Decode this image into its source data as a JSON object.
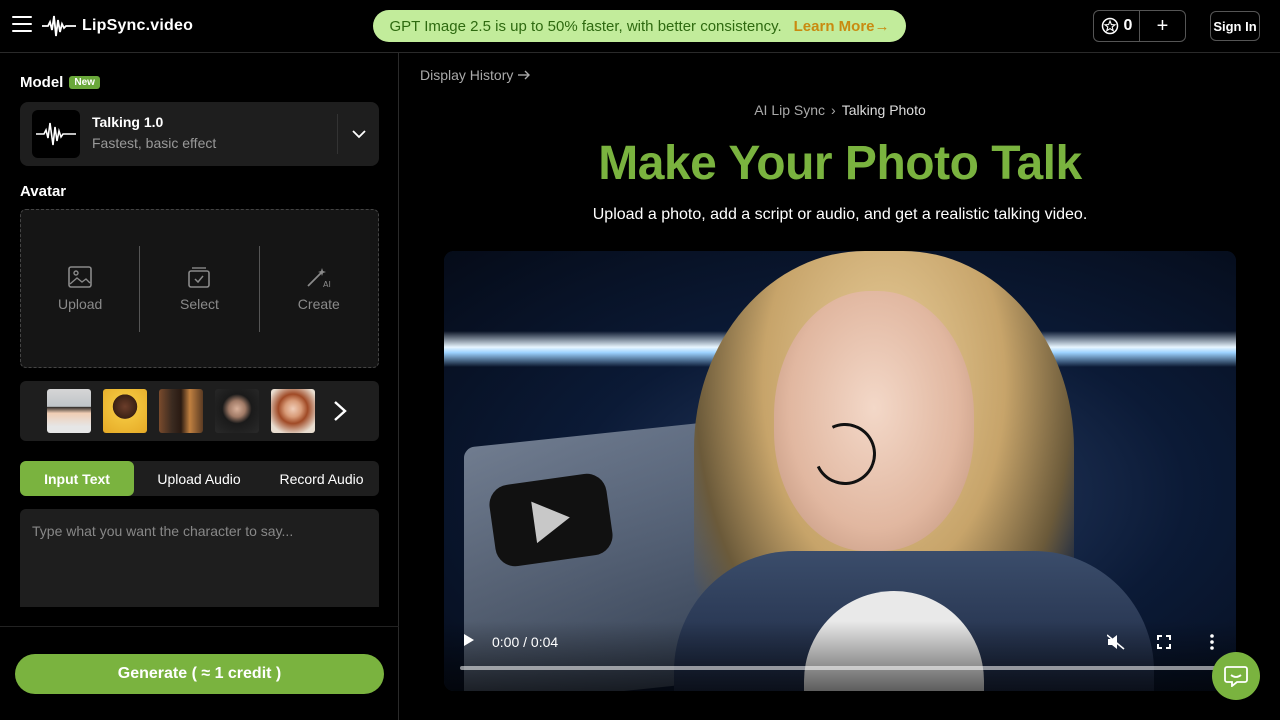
{
  "header": {
    "logo_text": "LipSync.video",
    "banner_text": "GPT Image 2.5 is up to 50% faster, with better consistency.",
    "banner_link": "Learn More→",
    "credits_count": "0",
    "add_label": "+",
    "signin_label": "Sign In"
  },
  "left": {
    "model_label": "Model",
    "model_badge": "New",
    "model_name": "Talking 1.0",
    "model_desc": "Fastest, basic effect",
    "avatar_label": "Avatar",
    "avatar_options": [
      {
        "label": "Upload"
      },
      {
        "label": "Select"
      },
      {
        "label": "Create"
      }
    ],
    "tabs": [
      {
        "label": "Input Text",
        "active": true
      },
      {
        "label": "Upload Audio",
        "active": false
      },
      {
        "label": "Record Audio",
        "active": false
      }
    ],
    "text_placeholder": "Type what you want the character to say...",
    "generate_label": "Generate ( ≈ 1 credit )"
  },
  "main": {
    "history_label": "Display History",
    "breadcrumb": [
      "AI Lip Sync",
      "Talking Photo"
    ],
    "title": "Make Your Photo Talk",
    "subtitle": "Upload a photo, add a script or audio, and get a realistic talking video.",
    "video_time": "0:00 / 0:04"
  },
  "colors": {
    "accent": "#7ab33f",
    "banner_bg": "#c2ec9b",
    "banner_text": "#2e6a10",
    "banner_link": "#c98a10"
  }
}
